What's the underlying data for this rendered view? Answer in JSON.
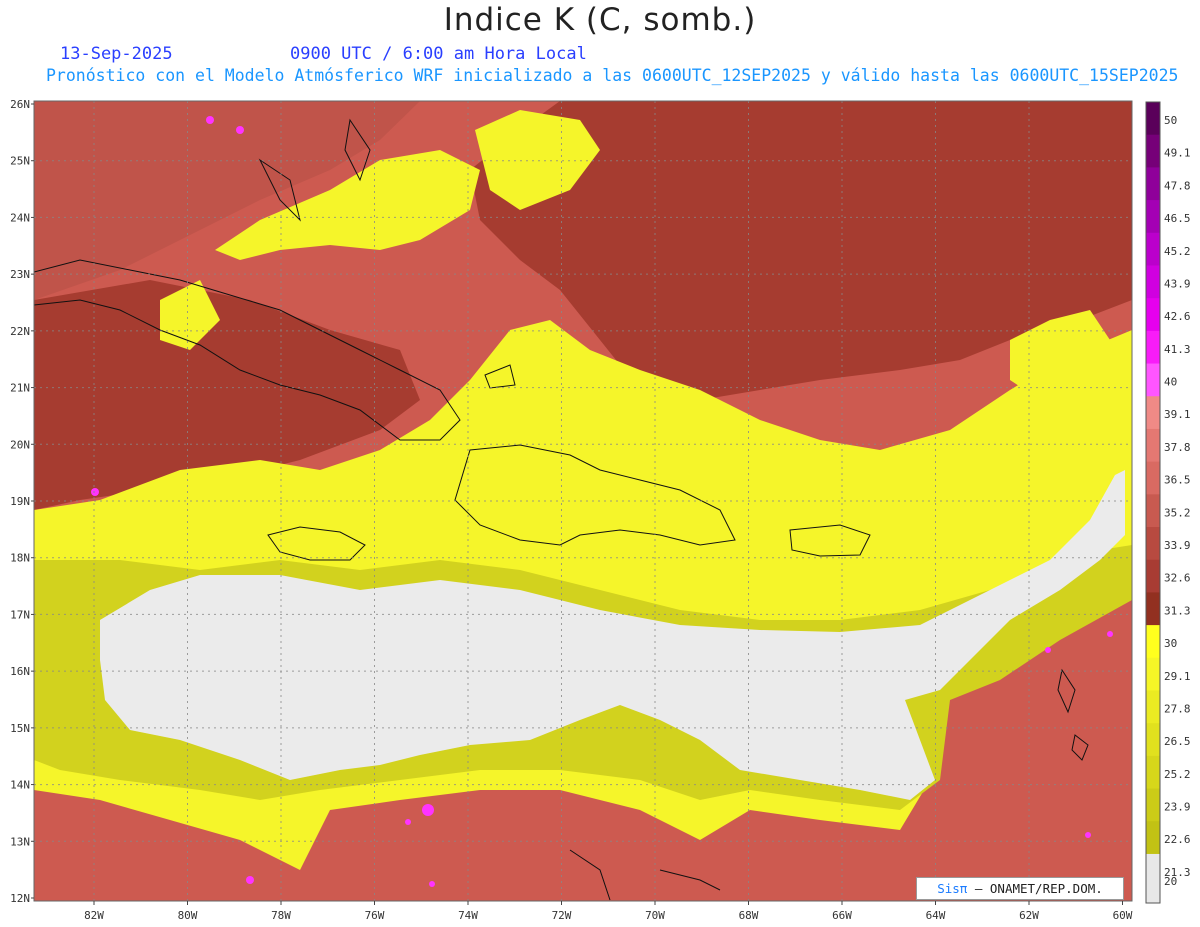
{
  "header": {
    "title": "Indice K (C, somb.)",
    "date": "13-Sep-2025",
    "time": "0900 UTC / 6:00 am Hora Local",
    "subtitle": "Pronóstico con el Modelo Atmósferico WRF inicializado a las 0600UTC_12SEP2025 y válido hasta las  0600UTC_15SEP2025"
  },
  "map": {
    "lat_labels": [
      "26N",
      "25N",
      "24N",
      "23N",
      "22N",
      "21N",
      "20N",
      "19N",
      "18N",
      "17N",
      "16N",
      "15N",
      "14N",
      "13N",
      "12N"
    ],
    "lon_labels": [
      "82W",
      "80W",
      "78W",
      "76W",
      "74W",
      "72W",
      "70W",
      "68W",
      "66W",
      "64W",
      "62W",
      "60W"
    ],
    "colors": {
      "low": "#ebebeb",
      "mid_yellow": "#f5f52a",
      "mid_olive": "#c9c91e",
      "high": "#cd5a50",
      "very_high": "#a3372b",
      "extreme": "#ff33ff"
    }
  },
  "colorbar": {
    "labels": [
      "50",
      "49.1",
      "47.8",
      "46.5",
      "45.2",
      "43.9",
      "42.6",
      "41.3",
      "40",
      "39.1",
      "37.8",
      "36.5",
      "35.2",
      "33.9",
      "32.6",
      "31.3",
      "30",
      "29.1",
      "27.8",
      "26.5",
      "25.2",
      "23.9",
      "22.6",
      "21.3",
      "20"
    ],
    "colors": [
      "#5a005a",
      "#760078",
      "#8f009a",
      "#a400b4",
      "#bb00cc",
      "#d000e0",
      "#e600ee",
      "#f81cf8",
      "#ff55ff",
      "#f08a86",
      "#e47872",
      "#d96a62",
      "#c85a50",
      "#b84a40",
      "#a83c33",
      "#923020",
      "#ffff1e",
      "#f6f626",
      "#ebeb22",
      "#e1e11e",
      "#d7d71a",
      "#cccc17",
      "#c2c214",
      "#e8e8e8"
    ]
  },
  "credit": {
    "sis": "Sisπ",
    "text": "– ONAMET/REP.DOM."
  }
}
